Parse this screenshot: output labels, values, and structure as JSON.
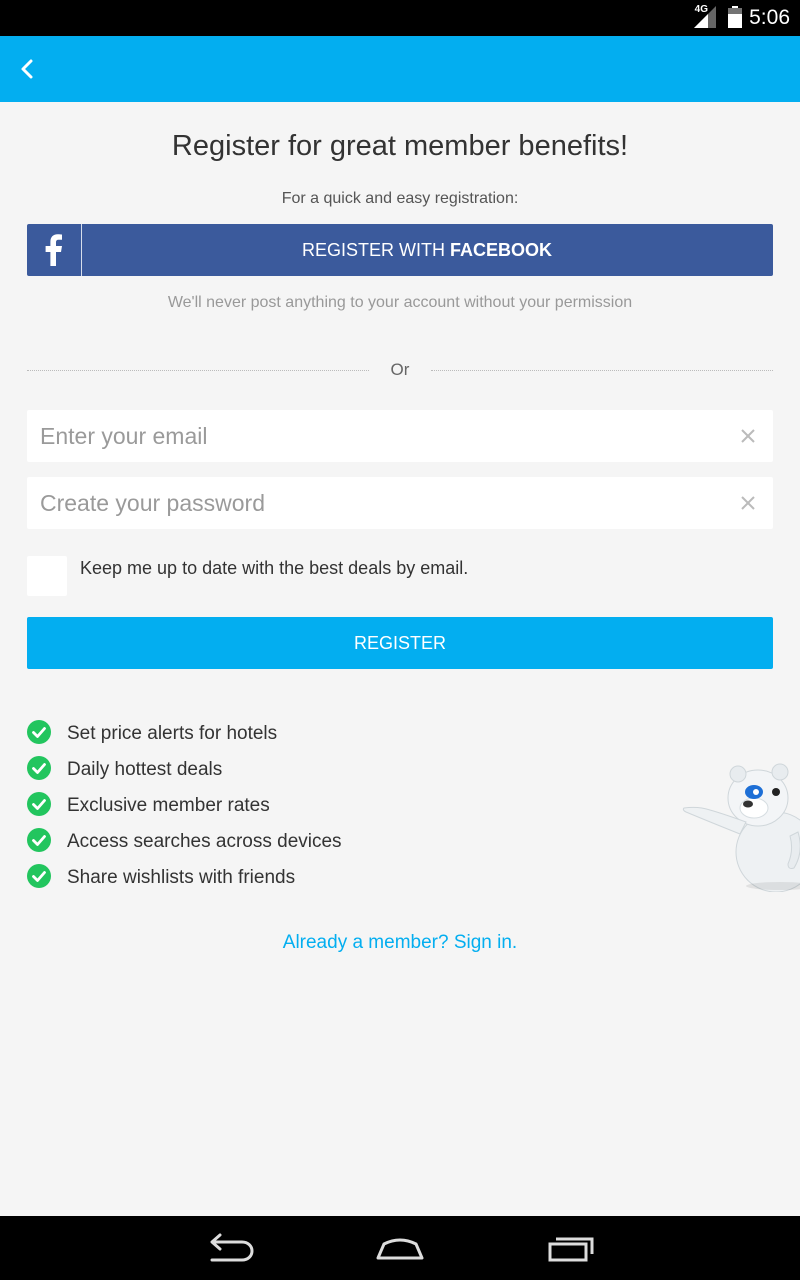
{
  "status_bar": {
    "time": "5:06",
    "network": "4G",
    "icons": [
      "signal-icon",
      "battery-icon"
    ]
  },
  "app_bar": {
    "back_icon": "back-chevron-icon",
    "color": "#03aef0"
  },
  "header": {
    "title": "Register for great member benefits!",
    "subtitle": "For a quick and easy registration:"
  },
  "facebook": {
    "label_prefix": "REGISTER WITH ",
    "label_bold": "FACEBOOK",
    "icon": "facebook-f-icon",
    "color": "#3b5a9c",
    "note": "We'll never post anything to your account without your permission"
  },
  "divider": {
    "text": "Or"
  },
  "form": {
    "email_placeholder": "Enter your email",
    "email_value": "",
    "password_placeholder": "Create your password",
    "password_value": "",
    "newsletter_label": "Keep me up to date with the best deals by email.",
    "newsletter_checked": false,
    "register_label": "REGISTER"
  },
  "benefits": [
    "Set price alerts for hotels",
    "Daily hottest deals",
    "Exclusive member rates",
    "Access searches across devices",
    "Share wishlists with friends"
  ],
  "signin": {
    "label": "Already a member? Sign in."
  },
  "nav_bar": {
    "icons": [
      "back-nav-icon",
      "home-nav-icon",
      "recents-nav-icon"
    ]
  },
  "colors": {
    "accent": "#03aef0",
    "check": "#22c55e",
    "background": "#f5f5f5"
  }
}
